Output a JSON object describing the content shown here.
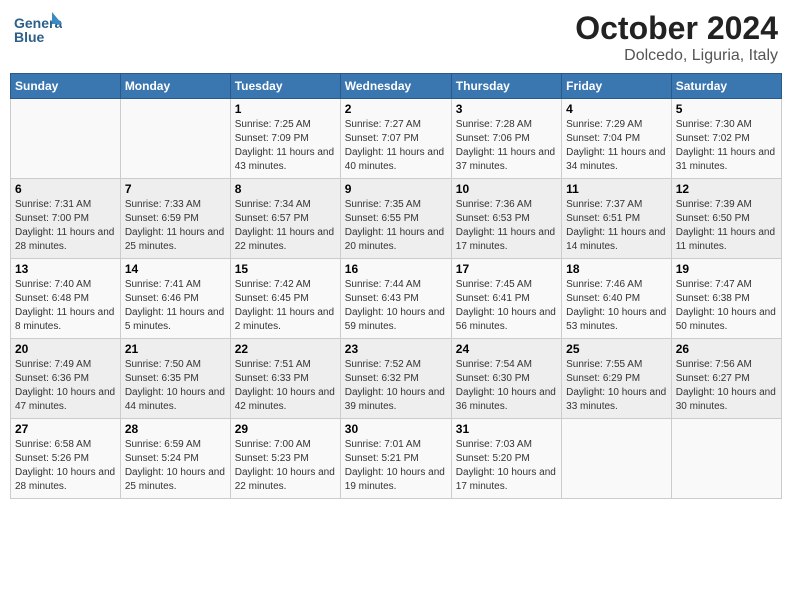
{
  "logo": {
    "line1": "General",
    "line2": "Blue"
  },
  "title": "October 2024",
  "location": "Dolcedo, Liguria, Italy",
  "weekdays": [
    "Sunday",
    "Monday",
    "Tuesday",
    "Wednesday",
    "Thursday",
    "Friday",
    "Saturday"
  ],
  "weeks": [
    [
      {
        "day": "",
        "info": ""
      },
      {
        "day": "",
        "info": ""
      },
      {
        "day": "1",
        "info": "Sunrise: 7:25 AM\nSunset: 7:09 PM\nDaylight: 11 hours and 43 minutes."
      },
      {
        "day": "2",
        "info": "Sunrise: 7:27 AM\nSunset: 7:07 PM\nDaylight: 11 hours and 40 minutes."
      },
      {
        "day": "3",
        "info": "Sunrise: 7:28 AM\nSunset: 7:06 PM\nDaylight: 11 hours and 37 minutes."
      },
      {
        "day": "4",
        "info": "Sunrise: 7:29 AM\nSunset: 7:04 PM\nDaylight: 11 hours and 34 minutes."
      },
      {
        "day": "5",
        "info": "Sunrise: 7:30 AM\nSunset: 7:02 PM\nDaylight: 11 hours and 31 minutes."
      }
    ],
    [
      {
        "day": "6",
        "info": "Sunrise: 7:31 AM\nSunset: 7:00 PM\nDaylight: 11 hours and 28 minutes."
      },
      {
        "day": "7",
        "info": "Sunrise: 7:33 AM\nSunset: 6:59 PM\nDaylight: 11 hours and 25 minutes."
      },
      {
        "day": "8",
        "info": "Sunrise: 7:34 AM\nSunset: 6:57 PM\nDaylight: 11 hours and 22 minutes."
      },
      {
        "day": "9",
        "info": "Sunrise: 7:35 AM\nSunset: 6:55 PM\nDaylight: 11 hours and 20 minutes."
      },
      {
        "day": "10",
        "info": "Sunrise: 7:36 AM\nSunset: 6:53 PM\nDaylight: 11 hours and 17 minutes."
      },
      {
        "day": "11",
        "info": "Sunrise: 7:37 AM\nSunset: 6:51 PM\nDaylight: 11 hours and 14 minutes."
      },
      {
        "day": "12",
        "info": "Sunrise: 7:39 AM\nSunset: 6:50 PM\nDaylight: 11 hours and 11 minutes."
      }
    ],
    [
      {
        "day": "13",
        "info": "Sunrise: 7:40 AM\nSunset: 6:48 PM\nDaylight: 11 hours and 8 minutes."
      },
      {
        "day": "14",
        "info": "Sunrise: 7:41 AM\nSunset: 6:46 PM\nDaylight: 11 hours and 5 minutes."
      },
      {
        "day": "15",
        "info": "Sunrise: 7:42 AM\nSunset: 6:45 PM\nDaylight: 11 hours and 2 minutes."
      },
      {
        "day": "16",
        "info": "Sunrise: 7:44 AM\nSunset: 6:43 PM\nDaylight: 10 hours and 59 minutes."
      },
      {
        "day": "17",
        "info": "Sunrise: 7:45 AM\nSunset: 6:41 PM\nDaylight: 10 hours and 56 minutes."
      },
      {
        "day": "18",
        "info": "Sunrise: 7:46 AM\nSunset: 6:40 PM\nDaylight: 10 hours and 53 minutes."
      },
      {
        "day": "19",
        "info": "Sunrise: 7:47 AM\nSunset: 6:38 PM\nDaylight: 10 hours and 50 minutes."
      }
    ],
    [
      {
        "day": "20",
        "info": "Sunrise: 7:49 AM\nSunset: 6:36 PM\nDaylight: 10 hours and 47 minutes."
      },
      {
        "day": "21",
        "info": "Sunrise: 7:50 AM\nSunset: 6:35 PM\nDaylight: 10 hours and 44 minutes."
      },
      {
        "day": "22",
        "info": "Sunrise: 7:51 AM\nSunset: 6:33 PM\nDaylight: 10 hours and 42 minutes."
      },
      {
        "day": "23",
        "info": "Sunrise: 7:52 AM\nSunset: 6:32 PM\nDaylight: 10 hours and 39 minutes."
      },
      {
        "day": "24",
        "info": "Sunrise: 7:54 AM\nSunset: 6:30 PM\nDaylight: 10 hours and 36 minutes."
      },
      {
        "day": "25",
        "info": "Sunrise: 7:55 AM\nSunset: 6:29 PM\nDaylight: 10 hours and 33 minutes."
      },
      {
        "day": "26",
        "info": "Sunrise: 7:56 AM\nSunset: 6:27 PM\nDaylight: 10 hours and 30 minutes."
      }
    ],
    [
      {
        "day": "27",
        "info": "Sunrise: 6:58 AM\nSunset: 5:26 PM\nDaylight: 10 hours and 28 minutes."
      },
      {
        "day": "28",
        "info": "Sunrise: 6:59 AM\nSunset: 5:24 PM\nDaylight: 10 hours and 25 minutes."
      },
      {
        "day": "29",
        "info": "Sunrise: 7:00 AM\nSunset: 5:23 PM\nDaylight: 10 hours and 22 minutes."
      },
      {
        "day": "30",
        "info": "Sunrise: 7:01 AM\nSunset: 5:21 PM\nDaylight: 10 hours and 19 minutes."
      },
      {
        "day": "31",
        "info": "Sunrise: 7:03 AM\nSunset: 5:20 PM\nDaylight: 10 hours and 17 minutes."
      },
      {
        "day": "",
        "info": ""
      },
      {
        "day": "",
        "info": ""
      }
    ]
  ]
}
